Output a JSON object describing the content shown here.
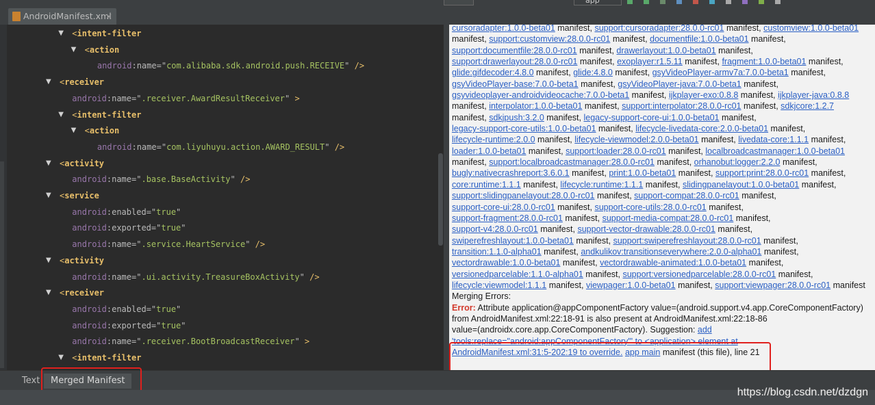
{
  "editor_tab": {
    "file_name": "AndroidManifest.xml",
    "close_glyph": "×"
  },
  "toolbar": {
    "run_config": "app"
  },
  "xml_lines": [
    {
      "indent": 1,
      "fold": "▼",
      "type": "open",
      "tag": "intent-filter"
    },
    {
      "indent": 2,
      "fold": "▼",
      "type": "open",
      "tag": "action"
    },
    {
      "indent": 3,
      "fold": "",
      "type": "attr",
      "ns": "android",
      "name": "name",
      "value": "com.alibaba.sdk.android.push.RECEIVE",
      "tail": " />"
    },
    {
      "indent": 0,
      "fold": "▼",
      "type": "open",
      "tag": "receiver"
    },
    {
      "indent": 1,
      "fold": "",
      "type": "attr",
      "ns": "android",
      "name": "name",
      "value": ".receiver.AwardResultReceiver",
      "tail": " >"
    },
    {
      "indent": 1,
      "fold": "▼",
      "type": "open",
      "tag": "intent-filter"
    },
    {
      "indent": 2,
      "fold": "▼",
      "type": "open",
      "tag": "action"
    },
    {
      "indent": 3,
      "fold": "",
      "type": "attr",
      "ns": "android",
      "name": "name",
      "value": "com.liyuhuyu.action.AWARD_RESULT",
      "tail": " />"
    },
    {
      "indent": 0,
      "fold": "▼",
      "type": "open",
      "tag": "activity"
    },
    {
      "indent": 1,
      "fold": "",
      "type": "attr",
      "ns": "android",
      "name": "name",
      "value": ".base.BaseActivity",
      "tail": " />"
    },
    {
      "indent": 0,
      "fold": "▼",
      "type": "open",
      "tag": "service"
    },
    {
      "indent": 1,
      "fold": "",
      "type": "attr",
      "ns": "android",
      "name": "enabled",
      "value": "true",
      "tail": ""
    },
    {
      "indent": 1,
      "fold": "",
      "type": "attr",
      "ns": "android",
      "name": "exported",
      "value": "true",
      "tail": ""
    },
    {
      "indent": 1,
      "fold": "",
      "type": "attr",
      "ns": "android",
      "name": "name",
      "value": ".service.HeartService",
      "tail": " />"
    },
    {
      "indent": 0,
      "fold": "▼",
      "type": "open",
      "tag": "activity"
    },
    {
      "indent": 1,
      "fold": "",
      "type": "attr",
      "ns": "android",
      "name": "name",
      "value": ".ui.activity.TreasureBoxActivity",
      "tail": " />"
    },
    {
      "indent": 0,
      "fold": "▼",
      "type": "open",
      "tag": "receiver"
    },
    {
      "indent": 1,
      "fold": "",
      "type": "attr",
      "ns": "android",
      "name": "enabled",
      "value": "true",
      "tail": ""
    },
    {
      "indent": 1,
      "fold": "",
      "type": "attr",
      "ns": "android",
      "name": "exported",
      "value": "true",
      "tail": ""
    },
    {
      "indent": 1,
      "fold": "",
      "type": "attr",
      "ns": "android",
      "name": "name",
      "value": ".receiver.BootBroadcastReceiver",
      "tail": " >"
    },
    {
      "indent": 1,
      "fold": "▼",
      "type": "open",
      "tag": "intent-filter"
    }
  ],
  "merged_lines": [
    [
      {
        "t": "cursoradapter:1.0.0-beta01",
        "link": true
      },
      {
        "t": " manifest, "
      },
      {
        "t": "support:cursoradapter:28.0.0-rc01",
        "link": true
      },
      {
        "t": " manifest, "
      },
      {
        "t": "customview:1.0.0-beta01",
        "link": true
      }
    ],
    [
      {
        "t": "manifest, "
      },
      {
        "t": "support:customview:28.0.0-rc01",
        "link": true
      },
      {
        "t": " manifest, "
      },
      {
        "t": "documentfile:1.0.0-beta01",
        "link": true
      },
      {
        "t": " manifest,"
      }
    ],
    [
      {
        "t": "support:documentfile:28.0.0-rc01",
        "link": true
      },
      {
        "t": " manifest, "
      },
      {
        "t": "drawerlayout:1.0.0-beta01",
        "link": true
      },
      {
        "t": " manifest,"
      }
    ],
    [
      {
        "t": "support:drawerlayout:28.0.0-rc01",
        "link": true
      },
      {
        "t": " manifest, "
      },
      {
        "t": "exoplayer:r1.5.11",
        "link": true
      },
      {
        "t": " manifest, "
      },
      {
        "t": "fragment:1.0.0-beta01",
        "link": true
      },
      {
        "t": " manifest,"
      }
    ],
    [
      {
        "t": "glide:gifdecoder:4.8.0",
        "link": true
      },
      {
        "t": " manifest, "
      },
      {
        "t": "glide:4.8.0",
        "link": true
      },
      {
        "t": " manifest, "
      },
      {
        "t": "gsyVideoPlayer-armv7a:7.0.0-beta1",
        "link": true
      },
      {
        "t": " manifest,"
      }
    ],
    [
      {
        "t": "gsyVideoPlayer-base:7.0.0-beta1",
        "link": true
      },
      {
        "t": " manifest, "
      },
      {
        "t": "gsyVideoPlayer-java:7.0.0-beta1",
        "link": true
      },
      {
        "t": " manifest,"
      }
    ],
    [
      {
        "t": "gsyvideoplayer-androidvideocache:7.0.0-beta1",
        "link": true
      },
      {
        "t": " manifest, "
      },
      {
        "t": "ijkplayer-exo:0.8.8",
        "link": true
      },
      {
        "t": " manifest, "
      },
      {
        "t": "ijkplayer-java:0.8.8",
        "link": true
      }
    ],
    [
      {
        "t": "manifest, "
      },
      {
        "t": "interpolator:1.0.0-beta01",
        "link": true
      },
      {
        "t": " manifest, "
      },
      {
        "t": "support:interpolator:28.0.0-rc01",
        "link": true
      },
      {
        "t": " manifest, "
      },
      {
        "t": "sdkjcore:1.2.7",
        "link": true
      }
    ],
    [
      {
        "t": "manifest, "
      },
      {
        "t": "sdkjpush:3.2.0",
        "link": true
      },
      {
        "t": " manifest, "
      },
      {
        "t": "legacy-support-core-ui:1.0.0-beta01",
        "link": true
      },
      {
        "t": " manifest,"
      }
    ],
    [
      {
        "t": "legacy-support-core-utils:1.0.0-beta01",
        "link": true
      },
      {
        "t": " manifest, "
      },
      {
        "t": "lifecycle-livedata-core:2.0.0-beta01",
        "link": true
      },
      {
        "t": " manifest,"
      }
    ],
    [
      {
        "t": "lifecycle-runtime:2.0.0",
        "link": true
      },
      {
        "t": " manifest, "
      },
      {
        "t": "lifecycle-viewmodel:2.0.0-beta01",
        "link": true
      },
      {
        "t": " manifest, "
      },
      {
        "t": "livedata-core:1.1.1",
        "link": true
      },
      {
        "t": " manifest,"
      }
    ],
    [
      {
        "t": "loader:1.0.0-beta01",
        "link": true
      },
      {
        "t": " manifest, "
      },
      {
        "t": "support:loader:28.0.0-rc01",
        "link": true
      },
      {
        "t": " manifest, "
      },
      {
        "t": "localbroadcastmanager:1.0.0-beta01",
        "link": true
      }
    ],
    [
      {
        "t": "manifest, "
      },
      {
        "t": "support:localbroadcastmanager:28.0.0-rc01",
        "link": true
      },
      {
        "t": " manifest, "
      },
      {
        "t": "orhanobut:logger:2.2.0",
        "link": true
      },
      {
        "t": " manifest,"
      }
    ],
    [
      {
        "t": "bugly:nativecrashreport:3.6.0.1",
        "link": true
      },
      {
        "t": " manifest, "
      },
      {
        "t": "print:1.0.0-beta01",
        "link": true
      },
      {
        "t": " manifest, "
      },
      {
        "t": "support:print:28.0.0-rc01",
        "link": true
      },
      {
        "t": " manifest,"
      }
    ],
    [
      {
        "t": "core:runtime:1.1.1",
        "link": true
      },
      {
        "t": " manifest, "
      },
      {
        "t": "lifecycle:runtime:1.1.1",
        "link": true
      },
      {
        "t": " manifest, "
      },
      {
        "t": "slidingpanelayout:1.0.0-beta01",
        "link": true
      },
      {
        "t": " manifest,"
      }
    ],
    [
      {
        "t": "support:slidingpanelayout:28.0.0-rc01",
        "link": true
      },
      {
        "t": " manifest, "
      },
      {
        "t": "support-compat:28.0.0-rc01",
        "link": true
      },
      {
        "t": " manifest,"
      }
    ],
    [
      {
        "t": "support-core-ui:28.0.0-rc01",
        "link": true
      },
      {
        "t": " manifest, "
      },
      {
        "t": "support-core-utils:28.0.0-rc01",
        "link": true
      },
      {
        "t": " manifest,"
      }
    ],
    [
      {
        "t": "support-fragment:28.0.0-rc01",
        "link": true
      },
      {
        "t": " manifest, "
      },
      {
        "t": "support-media-compat:28.0.0-rc01",
        "link": true
      },
      {
        "t": " manifest,"
      }
    ],
    [
      {
        "t": "support-v4:28.0.0-rc01",
        "link": true
      },
      {
        "t": " manifest, "
      },
      {
        "t": "support-vector-drawable:28.0.0-rc01",
        "link": true
      },
      {
        "t": " manifest,"
      }
    ],
    [
      {
        "t": "swiperefreshlayout:1.0.0-beta01",
        "link": true
      },
      {
        "t": " manifest, "
      },
      {
        "t": "support:swiperefreshlayout:28.0.0-rc01",
        "link": true
      },
      {
        "t": " manifest,"
      }
    ],
    [
      {
        "t": "transition:1.1.0-alpha01",
        "link": true
      },
      {
        "t": " manifest, "
      },
      {
        "t": "andkulikov:transitionseverywhere:2.0.0-alpha01",
        "link": true
      },
      {
        "t": " manifest,"
      }
    ],
    [
      {
        "t": "vectordrawable:1.0.0-beta01",
        "link": true
      },
      {
        "t": " manifest, "
      },
      {
        "t": "vectordrawable-animated:1.0.0-beta01",
        "link": true
      },
      {
        "t": " manifest,"
      }
    ],
    [
      {
        "t": "versionedparcelable:1.1.0-alpha01",
        "link": true
      },
      {
        "t": " manifest, "
      },
      {
        "t": "support:versionedparcelable:28.0.0-rc01",
        "link": true
      },
      {
        "t": " manifest,"
      }
    ],
    [
      {
        "t": "lifecycle:viewmodel:1.1.1",
        "link": true
      },
      {
        "t": " manifest, "
      },
      {
        "t": "viewpager:1.0.0-beta01",
        "link": true
      },
      {
        "t": " manifest, "
      },
      {
        "t": "support:viewpager:28.0.0-rc01",
        "link": true
      },
      {
        "t": " manifest"
      }
    ]
  ],
  "merging_errors": {
    "title": "Merging Errors:",
    "label": "Error:",
    "line1": " Attribute application@appComponentFactory value=(android.support.v4.app.CoreComponentFactory)",
    "line2": "from AndroidManifest.xml:22:18-91 is also present at AndroidManifest.xml:22:18-86",
    "line3_text": "value=(androidx.core.app.CoreComponentFactory). Suggestion: ",
    "line3_link": "add",
    "line4_link": "'tools:replace=\"android:appComponentFactory\"' to <application> element at",
    "line5_link1": "AndroidManifest.xml:31:5-202:19 to override.",
    "line5_link2": "app main",
    "line5_tail": " manifest (this file), line 21"
  },
  "bottom_tabs": {
    "text": "Text",
    "merged": "Merged Manifest"
  },
  "watermark": "https://blog.csdn.net/dzdgn",
  "colors": {
    "error_red": "#e0201d",
    "link_blue": "#2a5fc4",
    "xml_tag": "#e8bf6a",
    "xml_value": "#a5c261",
    "xml_namespace": "#9876aa"
  }
}
